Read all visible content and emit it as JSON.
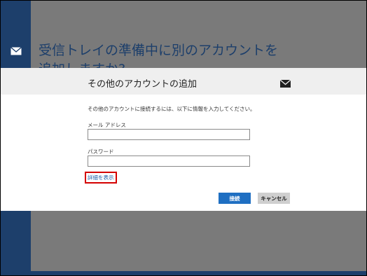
{
  "background": {
    "title": "受信トレイの準備中に別のアカウントを追加しますか?",
    "side_icon": "mail-icon"
  },
  "dialog": {
    "title": "その他のアカウントの追加",
    "header_icon": "mail-icon",
    "instruction": "その他のアカウントに接続するには、以下に情報を入力してください。",
    "email": {
      "label": "メール アドレス",
      "value": "",
      "placeholder": ""
    },
    "password": {
      "label": "パスワード",
      "value": "",
      "placeholder": ""
    },
    "details_link": "詳細を表示",
    "connect_label": "接続",
    "cancel_label": "キャンセル"
  },
  "colors": {
    "accent": "#1f6fc2",
    "sidebar": "#1d3f6b",
    "overlay": "#7a7a7a",
    "highlight": "#d40000"
  }
}
